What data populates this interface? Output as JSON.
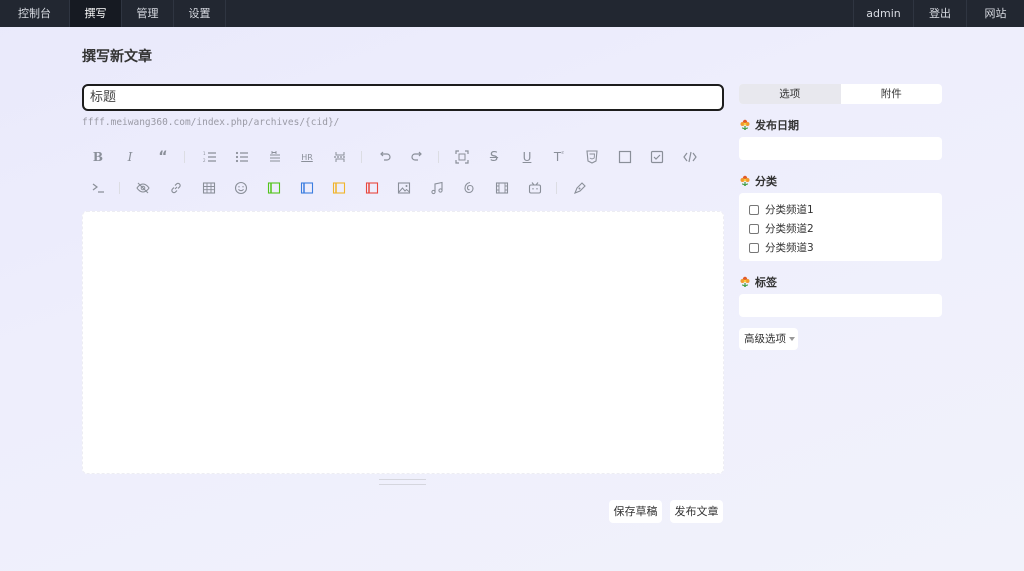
{
  "nav": {
    "left": [
      "控制台",
      "撰写",
      "管理",
      "设置"
    ],
    "right": [
      "admin",
      "登出",
      "网站"
    ]
  },
  "page": {
    "title": "撰写新文章",
    "title_placeholder": "标题",
    "permalink": "ffff.meiwang360.com/index.php/archives/{cid}/"
  },
  "toolbar": {
    "row1": [
      "bold-icon",
      "italic-icon",
      "quote-icon",
      "ordered-list-icon",
      "unordered-list-icon",
      "heading-icon",
      "hr-icon",
      "more-break-icon",
      "undo-icon",
      "redo-icon",
      "fullscreen-icon",
      "strikethrough-icon",
      "underline-icon",
      "superscript-icon",
      "html-icon",
      "checkbox-empty-icon",
      "checkbox-checked-icon",
      "code-icon"
    ],
    "row2": [
      "terminal-icon",
      "hide-icon",
      "link-icon",
      "table-icon",
      "emoji-icon",
      "callout-green-icon",
      "callout-blue-icon",
      "callout-yellow-icon",
      "callout-red-icon",
      "image-icon",
      "music-icon",
      "netease-icon",
      "video-icon",
      "bilibili-icon",
      "pen-icon"
    ],
    "hr_text": "HR"
  },
  "actions": {
    "save_draft": "保存草稿",
    "publish": "发布文章"
  },
  "sidebar": {
    "tabs": [
      "选项",
      "附件"
    ],
    "publish_date_label": "发布日期",
    "category_label": "分类",
    "categories": [
      "分类频道1",
      "分类频道2",
      "分类频道3"
    ],
    "tags_label": "标签",
    "advanced_label": "高级选项"
  },
  "colors": {
    "nav_bg": "#222731",
    "callout_green": "#52c41a",
    "callout_blue": "#3b7de0",
    "callout_yellow": "#f0b42a",
    "callout_red": "#e8483f"
  }
}
